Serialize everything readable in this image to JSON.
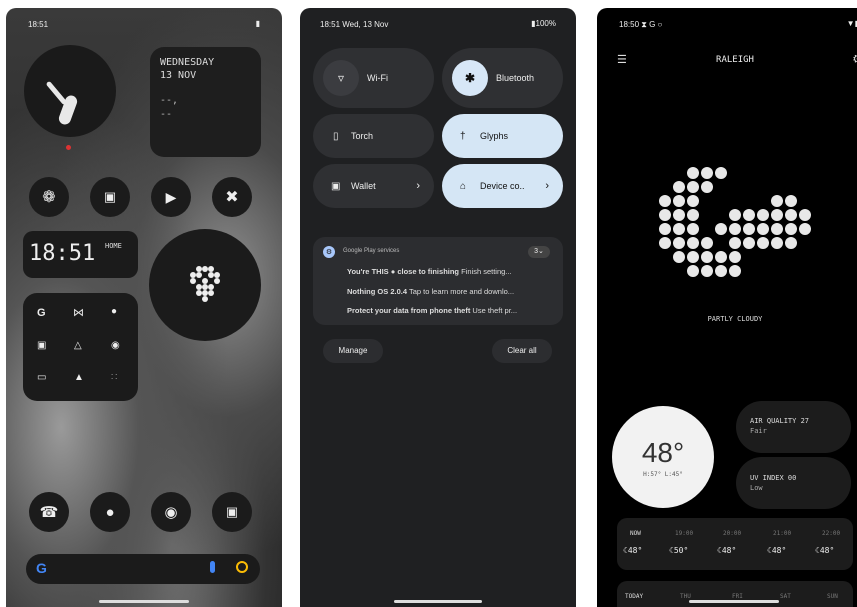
{
  "screen1": {
    "time": "18:51",
    "clock_day": "WEDNESDAY",
    "clock_date": "13 NOV",
    "clock_extra1": "--,",
    "clock_extra2": "--",
    "digital_time": "18:51",
    "digital_label": "HOME",
    "app_grid": [
      "G",
      "⋈",
      "●",
      "▣",
      "△",
      "◉",
      "▭",
      "▲",
      "∷"
    ],
    "dock": [
      "☎",
      "●",
      "◉",
      "▣"
    ],
    "search_logo": "G"
  },
  "screen2": {
    "status_left": "18:51  Wed, 13 Nov",
    "battery": "100%",
    "tiles": [
      {
        "label": "Wi-Fi",
        "icon": "wifi-icon",
        "active": false
      },
      {
        "label": "Bluetooth",
        "icon": "bluetooth-icon",
        "active": false
      },
      {
        "label": "Torch",
        "icon": "torch-icon",
        "active": false
      },
      {
        "label": "Glyphs",
        "icon": "glyphs-icon",
        "active": true
      },
      {
        "label": "Wallet",
        "icon": "wallet-icon",
        "active": false
      },
      {
        "label": "Device co..",
        "icon": "home-icon",
        "active": true
      }
    ],
    "notif_app": "Google Play services",
    "notif_count": "3",
    "notif_lines": [
      {
        "bold": "You're THIS ● close to finishing",
        "rest": " Finish setting..."
      },
      {
        "bold": "Nothing OS 2.0.4",
        "rest": " Tap to learn more and downlo..."
      },
      {
        "bold": "Protect your data from phone theft",
        "rest": " Use theft pr..."
      }
    ],
    "manage": "Manage",
    "clear_all": "Clear all"
  },
  "screen3": {
    "status_left": "18:50 ⧗ G ○",
    "city": "RALEIGH",
    "condition": "PARTLY CLOUDY",
    "temp": "48°",
    "hilo": "H:57° L:45°",
    "aq_label": "AIR QUALITY  27",
    "aq_value": "Fair",
    "uv_label": "UV INDEX 00",
    "uv_value": "Low",
    "hourly": [
      {
        "t": "NOW",
        "v": "☾48°"
      },
      {
        "t": "19:00",
        "v": "☾50°"
      },
      {
        "t": "20:00",
        "v": "☾48°"
      },
      {
        "t": "21:00",
        "v": "☾48°"
      },
      {
        "t": "22:00",
        "v": "☾48°"
      }
    ],
    "daily": [
      "TODAY",
      "THU",
      "FRI",
      "SAT",
      "SUN"
    ]
  }
}
